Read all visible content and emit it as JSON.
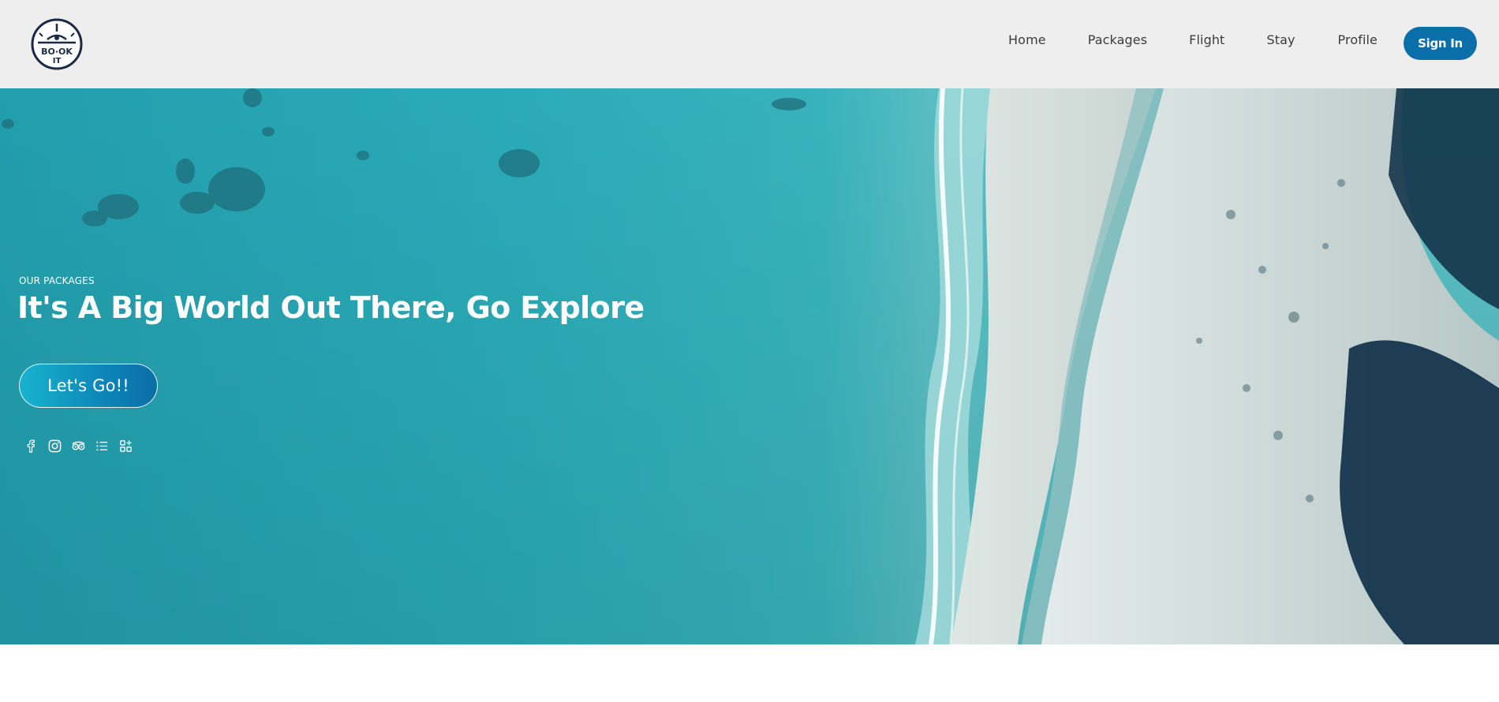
{
  "app": {
    "logo": {
      "icon": "book-it-plane-logo-icon",
      "text_top": "BO·OK",
      "text_bottom": "IT"
    }
  },
  "nav": {
    "items": [
      {
        "label": "Home"
      },
      {
        "label": "Packages"
      },
      {
        "label": "Flight"
      },
      {
        "label": "Stay"
      },
      {
        "label": "Profile"
      }
    ],
    "signin_label": "Sign In"
  },
  "hero": {
    "background": "aerial-beach-ocean-photo",
    "eyebrow": "OUR PACKAGES",
    "headline": "It's A Big World Out There, Go Explore",
    "cta_label": "Let's Go!!",
    "socials": [
      {
        "icon": "facebook-icon"
      },
      {
        "icon": "instagram-icon"
      },
      {
        "icon": "tripadvisor-icon"
      },
      {
        "icon": "list-icon"
      },
      {
        "icon": "apps-icon"
      }
    ]
  },
  "colors": {
    "nav_bg": "#eeeeee",
    "accent": "#0a6ea8",
    "ocean": "#2bb1bf",
    "text_nav": "#3c3c3c"
  }
}
